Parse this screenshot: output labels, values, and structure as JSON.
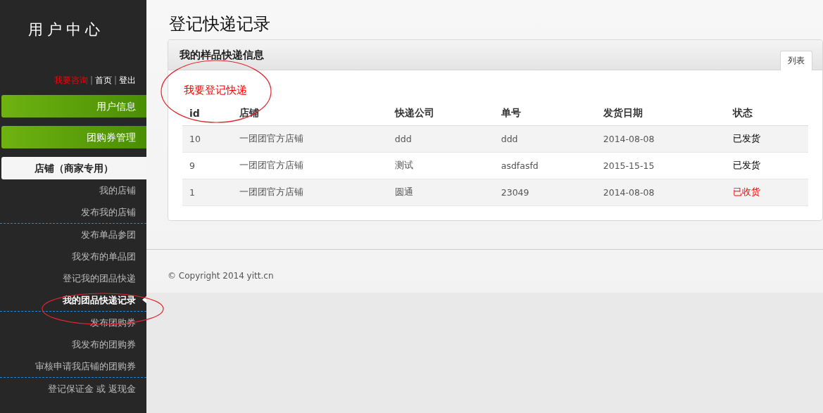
{
  "sidebar": {
    "title": "用户中心",
    "links": [
      {
        "label": "我要咨询",
        "highlighted": true
      },
      {
        "label": "首页",
        "highlighted": false
      },
      {
        "label": "登出",
        "highlighted": false
      }
    ],
    "link_separator": "|",
    "nav": [
      {
        "label": "用户信息",
        "kind": "green"
      },
      {
        "label": "团购券管理",
        "kind": "green"
      },
      {
        "label": "店铺（商家专用）",
        "kind": "section"
      }
    ],
    "groups": [
      {
        "items": [
          {
            "label": "我的店铺",
            "selected": false
          },
          {
            "label": "发布我的店铺",
            "selected": false
          }
        ]
      },
      {
        "items": [
          {
            "label": "发布单品参团",
            "selected": false
          },
          {
            "label": "我发布的单品团",
            "selected": false
          },
          {
            "label": "登记我的团品快递",
            "selected": false
          },
          {
            "label": "我的团品快递记录",
            "selected": true
          }
        ]
      },
      {
        "items": [
          {
            "label": "发布团购券",
            "selected": false
          },
          {
            "label": "我发布的团购券",
            "selected": false
          },
          {
            "label": "审核申请我店铺的团购券",
            "selected": false
          }
        ]
      },
      {
        "items": [
          {
            "label": "登记保证金 或 返现金",
            "selected": false
          }
        ]
      }
    ]
  },
  "page_title": "登记快递记录",
  "panel": {
    "title": "我的样品快递信息",
    "tabs": [
      {
        "label": "列表",
        "selected": true
      }
    ],
    "action_link": "我要登记快递",
    "table": {
      "columns": [
        "id",
        "店铺",
        "快递公司",
        "单号",
        "发货日期",
        "状态"
      ],
      "rows": [
        {
          "cells": [
            "10",
            "一团团官方店铺",
            "ddd",
            "ddd",
            "2014-08-08",
            "已发货"
          ],
          "status_highlighted": false
        },
        {
          "cells": [
            "9",
            "一团团官方店铺",
            "测试",
            "asdfasfd",
            "2015-15-15",
            "已发货"
          ],
          "status_highlighted": false
        },
        {
          "cells": [
            "1",
            "一团团官方店铺",
            "圆通",
            "23049",
            "2014-08-08",
            "已收货"
          ],
          "status_highlighted": true
        }
      ]
    }
  },
  "footer": {
    "copyright": "© Copyright 2014 yitt.cn"
  }
}
